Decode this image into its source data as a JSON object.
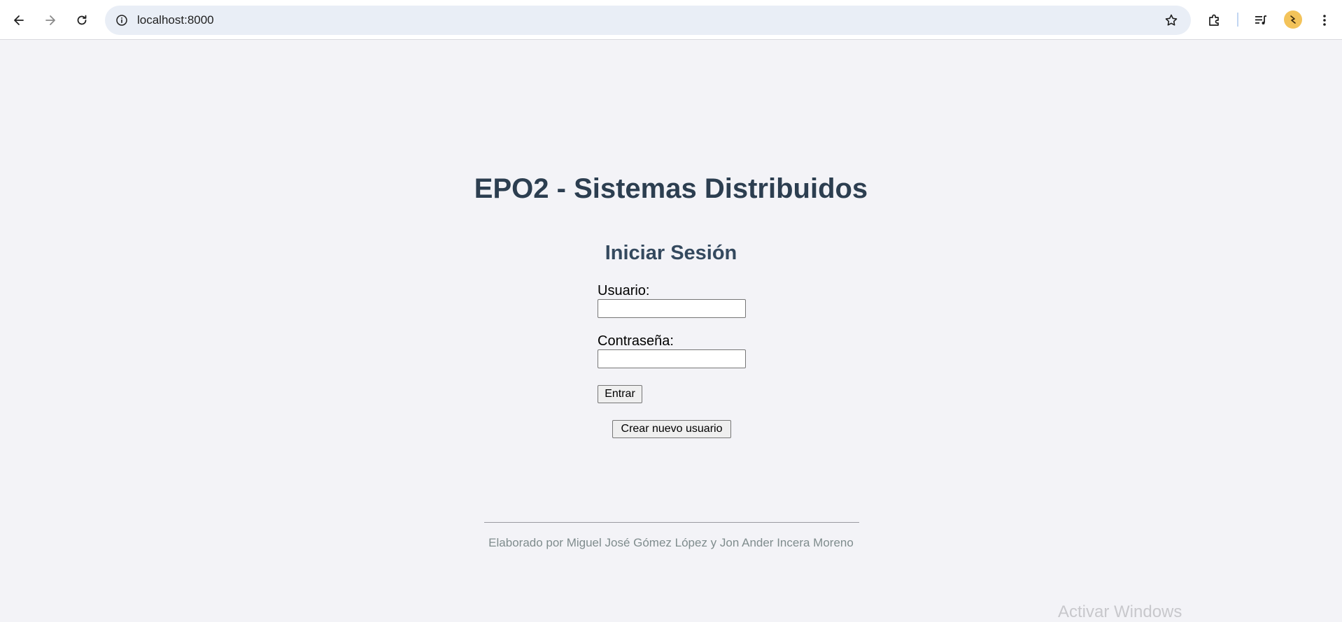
{
  "browser": {
    "url": "localhost:8000",
    "icons": [
      "back-arrow-icon",
      "forward-arrow-icon",
      "reload-icon",
      "site-info-icon",
      "bookmark-star-icon",
      "extensions-puzzle-icon",
      "media-queue-icon",
      "profile-avatar-icon",
      "kebab-menu-icon"
    ]
  },
  "page": {
    "title": "EPO2 - Sistemas Distribuidos",
    "subtitle": "Iniciar Sesión",
    "form": {
      "username_label": "Usuario:",
      "username_value": "",
      "password_label": "Contraseña:",
      "password_value": ""
    },
    "enter_button": "Entrar",
    "create_user_button": "Crear nuevo usuario",
    "footer": "Elaborado por Miguel José Gómez López y Jon Ander Incera Moreno",
    "watermark": "Activar Windows"
  }
}
